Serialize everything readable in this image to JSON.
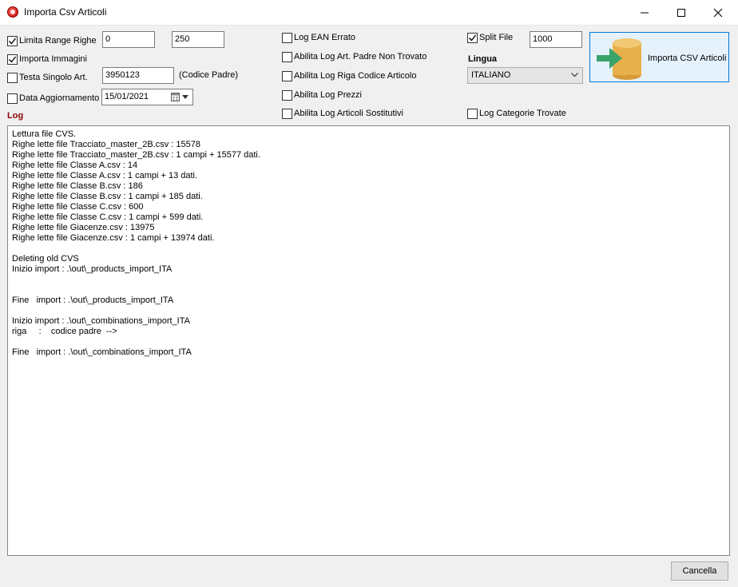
{
  "window": {
    "title": "Importa Csv Articoli"
  },
  "options": {
    "limita_range": {
      "label": "Limita Range Righe",
      "checked": true,
      "from": "0",
      "to": "250"
    },
    "importa_immagini": {
      "label": "Importa Immagini",
      "checked": true
    },
    "testa_singolo": {
      "label": "Testa Singolo Art.",
      "checked": false,
      "value": "3950123",
      "note": "(Codice Padre)"
    },
    "data_aggiornamento": {
      "label": "Data Aggiornamento",
      "checked": false,
      "value": "15/01/2021"
    }
  },
  "logs": {
    "ean": {
      "label": "Log EAN Errato",
      "checked": false
    },
    "padre": {
      "label": "Abilita Log Art. Padre Non Trovato",
      "checked": false
    },
    "riga": {
      "label": "Abilita Log Riga Codice Articolo",
      "checked": false
    },
    "prezzi": {
      "label": "Abilita Log Prezzi",
      "checked": false
    },
    "sostitutivi": {
      "label": "Abilita Log Articoli Sostitutivi",
      "checked": false
    },
    "categorie": {
      "label": "Log Categorie Trovate",
      "checked": false
    }
  },
  "split": {
    "label": "Split File",
    "checked": true,
    "value": "1000"
  },
  "lingua": {
    "label": "Lingua",
    "selected": "ITALIANO"
  },
  "import_button": {
    "label": "Importa CSV Articoli"
  },
  "log": {
    "title": "Log",
    "lines": [
      "Lettura file CVS.",
      "Righe lette file Tracciato_master_2B.csv : 15578",
      "Righe lette file Tracciato_master_2B.csv : 1 campi + 15577 dati.",
      "Righe lette file Classe A.csv : 14",
      "Righe lette file Classe A.csv : 1 campi + 13 dati.",
      "Righe lette file Classe B.csv : 186",
      "Righe lette file Classe B.csv : 1 campi + 185 dati.",
      "Righe lette file Classe C.csv : 600",
      "Righe lette file Classe C.csv : 1 campi + 599 dati.",
      "Righe lette file Giacenze.csv : 13975",
      "Righe lette file Giacenze.csv : 1 campi + 13974 dati.",
      "",
      "Deleting old CVS",
      "Inizio import : .\\out\\_products_import_ITA",
      "",
      "",
      "Fine   import : .\\out\\_products_import_ITA",
      "",
      "Inizio import : .\\out\\_combinations_import_ITA",
      "riga     :    codice padre  -->",
      "",
      "Fine   import : .\\out\\_combinations_import_ITA"
    ]
  },
  "cancel_button": {
    "label": "Cancella"
  },
  "colors": {
    "accent": "#0078d7",
    "log_title": "#8b0000",
    "db_icon": "#e8b04a",
    "arrow": "#3aa36b"
  }
}
